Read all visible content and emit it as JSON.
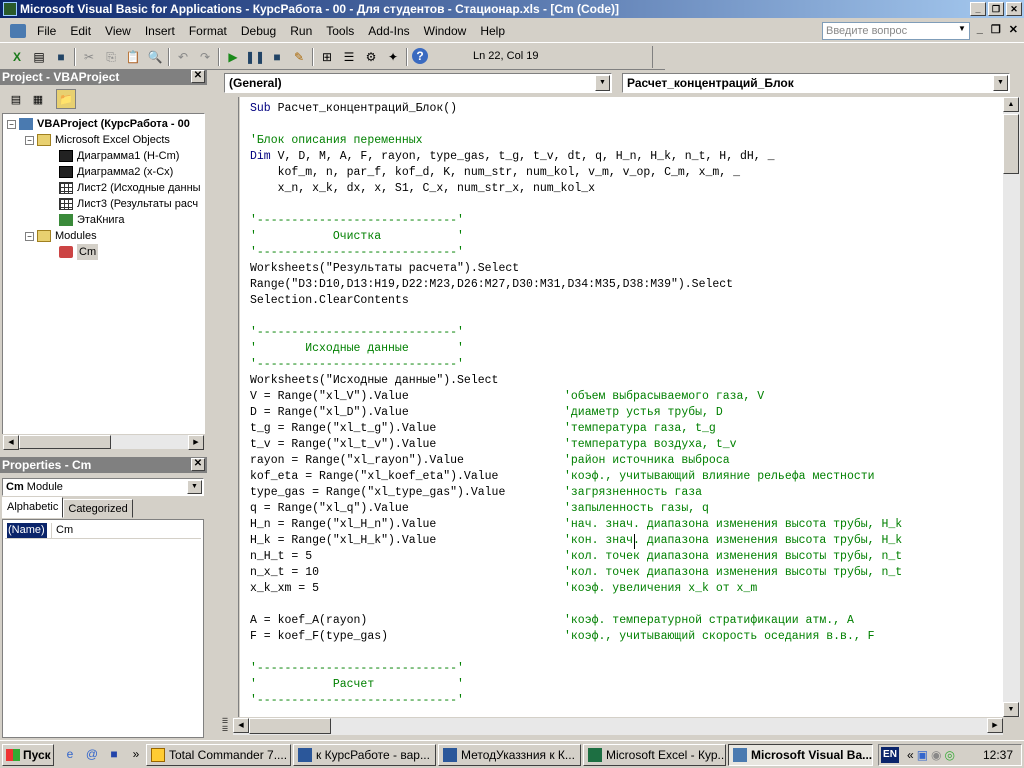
{
  "window": {
    "title": "Microsoft Visual Basic for Applications - КурсРабота - 00 - Для студентов - Стационар.xls - [Cm (Code)]"
  },
  "menu": {
    "items": [
      "File",
      "Edit",
      "View",
      "Insert",
      "Format",
      "Debug",
      "Run",
      "Tools",
      "Add-Ins",
      "Window",
      "Help"
    ],
    "ask_placeholder": "Введите вопрос"
  },
  "toolbar": {
    "position": "Ln 22, Col 19"
  },
  "project": {
    "header": "Project - VBAProject",
    "tree": [
      {
        "label": "VBAProject (КурсРабота - 00",
        "bold": true
      },
      {
        "label": "Microsoft Excel Objects"
      },
      {
        "label": "Диаграмма1 (H-Cm)"
      },
      {
        "label": "Диаграмма2 (x-Cx)"
      },
      {
        "label": "Лист2 (Исходные данны"
      },
      {
        "label": "Лист3 (Результаты расч"
      },
      {
        "label": "ЭтаКнига"
      },
      {
        "label": "Modules"
      },
      {
        "label": "Cm"
      }
    ]
  },
  "properties": {
    "header": "Properties - Cm",
    "combo_name": "Cm",
    "combo_type": "Module",
    "tabs": [
      "Alphabetic",
      "Categorized"
    ],
    "prop_name": "(Name)",
    "prop_value": "Cm"
  },
  "code": {
    "object_combo": "(General)",
    "proc_combo": "Расчет_концентраций_Блок",
    "lines": [
      "Sub Расчет_концентраций_Блок()",
      "",
      "'Блок описания переменных",
      "Dim V, D, M, A, F, rayon, type_gas, t_g, t_v, dt, q, H_n, H_k, n_t, H, dH, _",
      "    kof_m, n, par_f, kof_d, K, num_str, num_kol, v_m, v_op, C_m, x_m, _",
      "    x_n, x_k, dx, x, S1, C_x, num_str_x, num_kol_x",
      "",
      "'-----------------------------'",
      "'           Очистка           '",
      "'-----------------------------'",
      "Worksheets(\"Результаты расчета\").Select",
      "Range(\"D3:D10,D13:H19,D22:M23,D26:M27,D30:M31,D34:M35,D38:M39\").Select",
      "Selection.ClearContents",
      "",
      "'-----------------------------'",
      "'       Исходные данные       '",
      "'-----------------------------'",
      "Worksheets(\"Исходные данные\").Select",
      "V = Range(\"xl_V\").Value",
      "D = Range(\"xl_D\").Value",
      "t_g = Range(\"xl_t_g\").Value",
      "t_v = Range(\"xl_t_v\").Value",
      "rayon = Range(\"xl_rayon\").Value",
      "kof_eta = Range(\"xl_koef_eta\").Value",
      "type_gas = Range(\"xl_type_gas\").Value",
      "q = Range(\"xl_q\").Value",
      "H_n = Range(\"xl_H_n\").Value",
      "H_k = Range(\"xl_H_k\").Value",
      "n_H_t = 5",
      "n_x_t = 10",
      "x_k_xm = 5",
      "",
      "A = koef_A(rayon)",
      "F = koef_F(type_gas)",
      "",
      "'-----------------------------'",
      "'           Расчет            '",
      "'-----------------------------'"
    ],
    "comments": {
      "18": "'объем выбрасываемого газа, V",
      "19": "'диаметр устья трубы, D",
      "20": "'температура газа, t_g",
      "21": "'температура воздуха, t_v",
      "22": "'район источника выброса",
      "23": "'коэф., учитывающий влияние рельефа местности",
      "24": "'загрязненность газа",
      "25": "'запыленность газы, q",
      "26": "'нач. знач. диапазона изменения высота трубы, H_k",
      "27": "'кон. знач. диапазона изменения высота трубы, H_k",
      "28": "'кол. точек диапазона изменения высоты трубы, n_t",
      "29": "'кол. точек диапазона изменения высоты трубы, n_t",
      "30": "'коэф. увеличения x_k от x_m",
      "32": "'коэф. температурной стратификации атм., A",
      "33": "'коэф., учитывающий скорость оседания в.в., F"
    }
  },
  "taskbar": {
    "start": "Пуск",
    "tasks": [
      {
        "label": "Total Commander 7...."
      },
      {
        "label": "к КурсРаботе - вар..."
      },
      {
        "label": "МетодУказзния к К..."
      },
      {
        "label": "Microsoft Excel - Кур..."
      },
      {
        "label": "Microsoft Visual Ba...",
        "active": true
      }
    ],
    "lang": "EN",
    "clock": "12:37"
  }
}
